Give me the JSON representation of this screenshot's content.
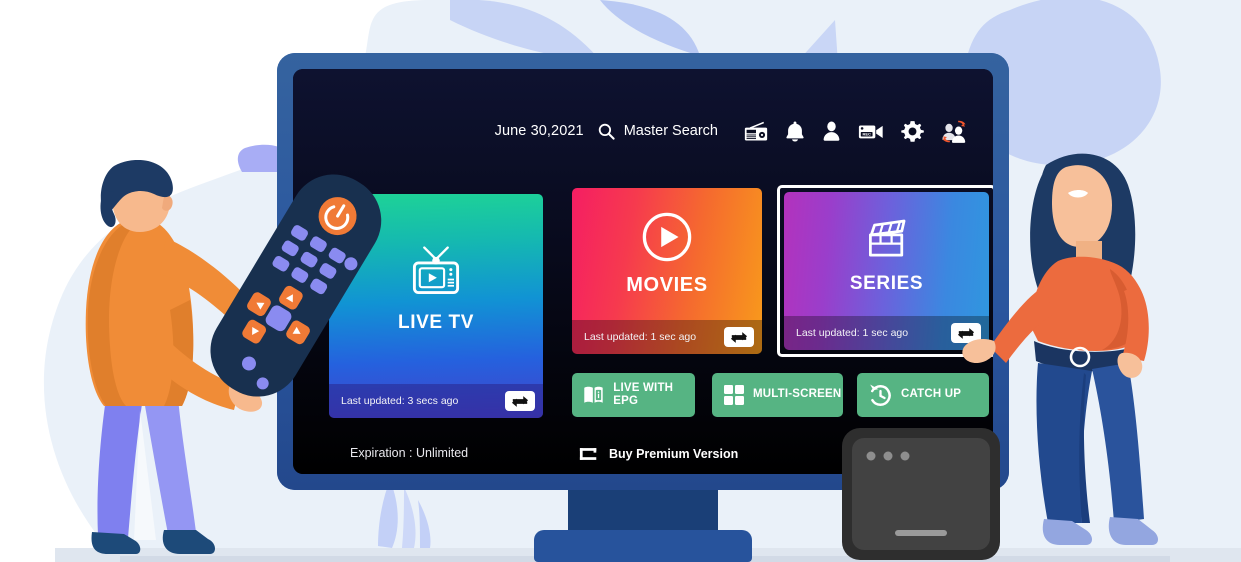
{
  "app": {
    "screen_background": "#0a0d22",
    "bezel_color": "#2d5ba9"
  },
  "topbar": {
    "date": "June 30,2021",
    "search_label": "Master Search",
    "search_icon": "search-icon",
    "icons": [
      {
        "name": "radio-icon",
        "label": "Radio"
      },
      {
        "name": "bell-icon",
        "label": "Notifications"
      },
      {
        "name": "person-icon",
        "label": "Account"
      },
      {
        "name": "rec-camera-icon",
        "label": "Recordings"
      },
      {
        "name": "gear-icon",
        "label": "Settings"
      },
      {
        "name": "switch-user-icon",
        "label": "Switch User"
      }
    ]
  },
  "tiles": [
    {
      "id": "live-tv",
      "title": "LIVE TV",
      "icon": "tv-play-icon",
      "status": "Last updated: 3 secs ago",
      "refresh_icon": "refresh-swap-icon",
      "gradient_from": "#1ed396",
      "gradient_to": "#4343c9",
      "selected": false
    },
    {
      "id": "movies",
      "title": "MOVIES",
      "icon": "play-circle-icon",
      "status": "Last updated: 1 sec ago",
      "refresh_icon": "refresh-swap-icon",
      "gradient_from": "#f51e63",
      "gradient_to": "#f89b1b",
      "selected": false
    },
    {
      "id": "series",
      "title": "SERIES",
      "icon": "clapperboard-icon",
      "status": "Last updated: 1 sec ago",
      "refresh_icon": "refresh-swap-icon",
      "gradient_from": "#b332bd",
      "gradient_to": "#2f97df",
      "selected": true
    }
  ],
  "quick_buttons": [
    {
      "id": "live-with-epg",
      "label": "LIVE WITH EPG",
      "icon": "epg-book-icon",
      "color": "#56b483"
    },
    {
      "id": "multi-screen",
      "label": "MULTI-SCREEN",
      "icon": "grid-four-icon",
      "color": "#56b483"
    },
    {
      "id": "catch-up",
      "label": "CATCH UP",
      "icon": "clock-rewind-icon",
      "color": "#56b483"
    }
  ],
  "footer": {
    "expiration": "Expiration : Unlimited",
    "premium_label": "Buy Premium Version",
    "premium_icon": "cart-icon"
  },
  "illustration": {
    "man": {
      "name": "man-holding-remote",
      "hair": "#1d3a64",
      "shirt": "#f08c37",
      "pants": "#8a8bf0",
      "shoes": "#1d4a79",
      "skin": "#f7b98d"
    },
    "woman": {
      "name": "woman-pointing-at-screen",
      "hair": "#1d3a64",
      "shirt": "#ec6b3e",
      "pants": "#22498e",
      "shoes": "#93a6e0",
      "skin": "#f7c09a"
    },
    "remote": {
      "name": "tv-remote-control",
      "body": "#18304f",
      "power_button": "#f07a36",
      "keys": "#8a8bf0",
      "arrow_keys": "#f07a36"
    },
    "set_top_box": {
      "name": "set-top-box",
      "body": "#3b3b3b",
      "shell": "#2e2e2e",
      "led_count": 3
    },
    "background": {
      "blob": "#eaf1f9",
      "accent_shapes": "#c7d4f5",
      "floor": "#dfe6ef"
    }
  }
}
